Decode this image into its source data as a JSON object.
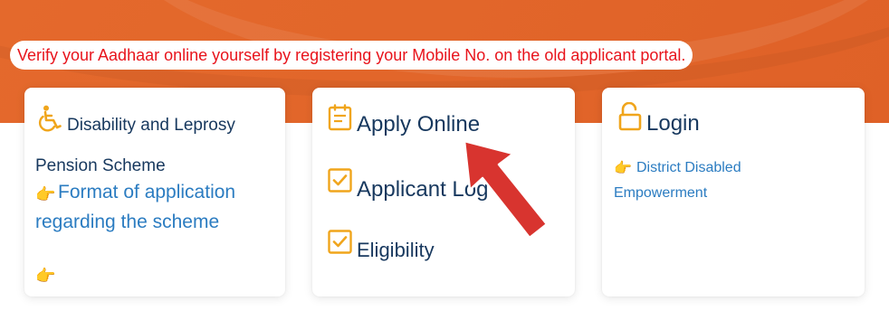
{
  "notice": {
    "text": "Verify your Aadhaar online yourself by registering your Mobile No. on the old applicant portal."
  },
  "colors": {
    "banner": "#e2662a",
    "notice_text": "#e8141c",
    "icon_accent": "#f0a51c",
    "heading": "#17385e",
    "link": "#2b7cc1",
    "arrow": "#d8342f"
  },
  "card1": {
    "title": "Disability and Leprosy",
    "subtitle": "Pension Scheme",
    "link_line1": "Format of application",
    "link_line2": "regarding the scheme",
    "icon": "wheelchair-icon"
  },
  "card2": {
    "apply": "Apply Online",
    "applicant_login": "Applicant Log",
    "eligibility": "Eligibility",
    "icons": [
      "form-icon",
      "checkbox-icon",
      "checkbox-icon"
    ]
  },
  "card3": {
    "title": "Login",
    "link_line1": "District Disabled",
    "link_line2": "Empowerment",
    "icon": "unlock-icon"
  }
}
